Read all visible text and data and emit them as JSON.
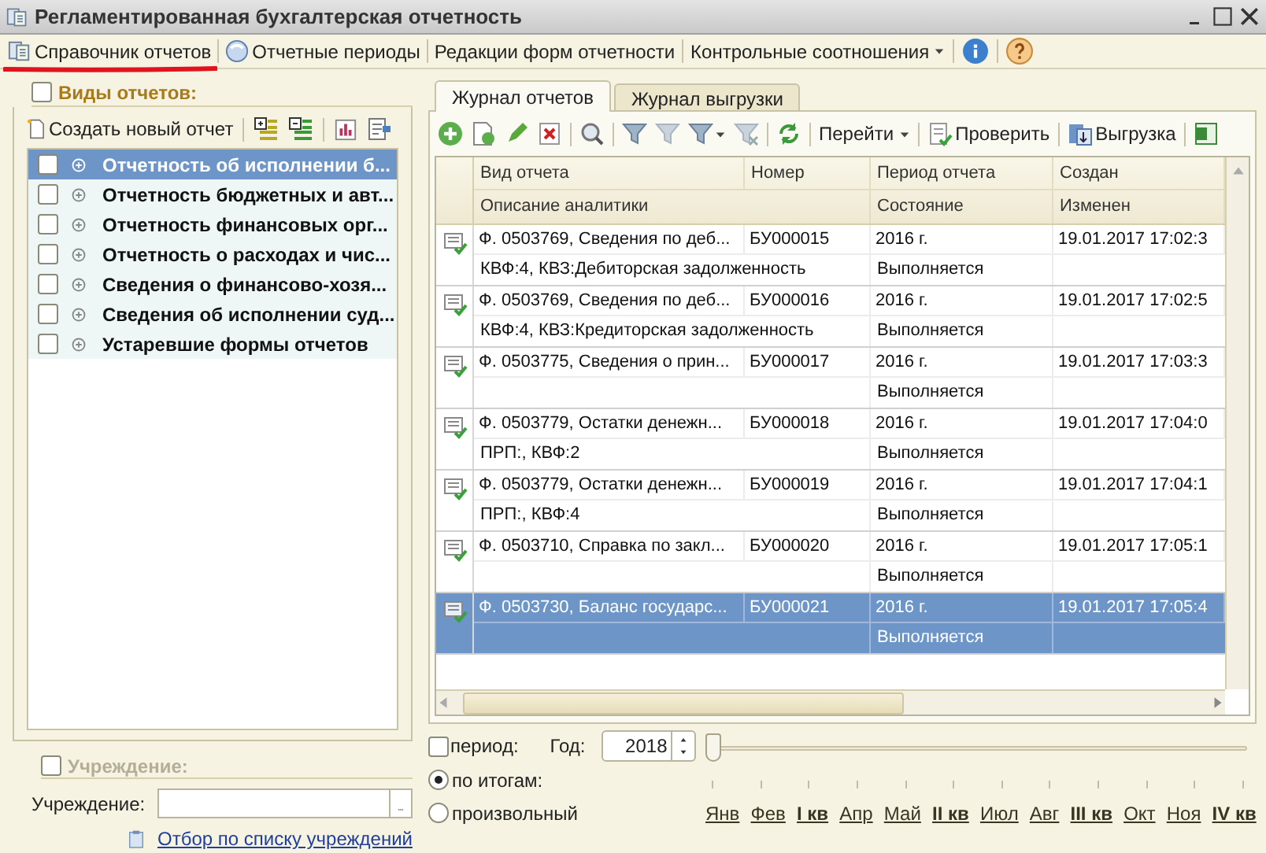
{
  "window": {
    "title": "Регламентированная бухгалтерская отчетность"
  },
  "toolbar": [
    {
      "kind": "button",
      "label": "Справочник отчетов"
    },
    {
      "kind": "button",
      "label": "Отчетные периоды"
    },
    {
      "kind": "button",
      "label": "Редакции форм отчетности"
    },
    {
      "kind": "menu",
      "label": "Контрольные соотношения"
    },
    {
      "kind": "icon"
    },
    {
      "kind": "icon"
    }
  ],
  "report_types": {
    "title": "Виды отчетов:",
    "checked": false,
    "create_button": "Создать новый отчет",
    "items": [
      {
        "label": "Отчетность об исполнении б...",
        "checked": false,
        "selected": true
      },
      {
        "label": "Отчетность бюджетных и авт...",
        "checked": false,
        "selected": false
      },
      {
        "label": "Отчетность финансовых орг...",
        "checked": false,
        "selected": false
      },
      {
        "label": "Отчетность о расходах и чис...",
        "checked": false,
        "selected": false
      },
      {
        "label": "Сведения о финансово-хозя...",
        "checked": false,
        "selected": false
      },
      {
        "label": "Сведения об исполнении суд...",
        "checked": false,
        "selected": false
      },
      {
        "label": "Устаревшие формы отчетов",
        "checked": false,
        "selected": false
      }
    ]
  },
  "institution": {
    "title": "Учреждение:",
    "checked": false,
    "field_label": "Учреждение:",
    "link": "Отбор по списку учреждений"
  },
  "tabs": [
    {
      "label": "Журнал отчетов",
      "selected": true
    },
    {
      "label": "Журнал выгрузки",
      "selected": false
    }
  ],
  "journal_toolbar": {
    "go": "Перейти",
    "check": "Проверить",
    "export": "Выгрузка"
  },
  "table": {
    "columns": [
      "Вид отчета",
      "Номер",
      "Период отчета",
      "Создан"
    ],
    "subcolumns": [
      "Описание аналитики",
      "Состояние",
      "Изменен"
    ],
    "rows": [
      {
        "type": "Ф. 0503769, Сведения по деб...",
        "number": "БУ000015",
        "period": "2016 г.",
        "created": "19.01.2017 17:02:3",
        "description": "КВФ:4, КВЗ:Дебиторская задолженность",
        "state": "Выполняется",
        "selected": false
      },
      {
        "type": "Ф. 0503769, Сведения по деб...",
        "number": "БУ000016",
        "period": "2016 г.",
        "created": "19.01.2017 17:02:5",
        "description": "КВФ:4, КВЗ:Кредиторская задолженность",
        "state": "Выполняется",
        "selected": false
      },
      {
        "type": "Ф. 0503775, Сведения о прин...",
        "number": "БУ000017",
        "period": "2016 г.",
        "created": "19.01.2017 17:03:3",
        "state": "Выполняется",
        "selected": false
      },
      {
        "type": "Ф. 0503779, Остатки денежн...",
        "number": "БУ000018",
        "period": "2016 г.",
        "created": "19.01.2017 17:04:0",
        "description": "ПРП:, КВФ:2",
        "state": "Выполняется",
        "selected": false
      },
      {
        "type": "Ф. 0503779, Остатки денежн...",
        "number": "БУ000019",
        "period": "2016 г.",
        "created": "19.01.2017 17:04:1",
        "description": "ПРП:, КВФ:4",
        "state": "Выполняется",
        "selected": false
      },
      {
        "type": "Ф. 0503710, Справка по закл...",
        "number": "БУ000020",
        "period": "2016 г.",
        "created": "19.01.2017 17:05:1",
        "state": "Выполняется",
        "selected": false
      },
      {
        "type": "Ф. 0503730, Баланс государс...",
        "number": "БУ000021",
        "period": "2016 г.",
        "created": "19.01.2017 17:05:4",
        "state": "Выполняется",
        "selected": true
      }
    ]
  },
  "period": {
    "label": "период:",
    "checked": false,
    "year_label": "Год:",
    "year": "2018",
    "level": 0,
    "modes": [
      {
        "label": "по итогам:",
        "selected": true
      },
      {
        "label": "произвольный",
        "selected": false
      }
    ],
    "months": [
      {
        "label": "Янв",
        "kind": "month"
      },
      {
        "label": "Фев",
        "kind": "month"
      },
      {
        "label": "I кв",
        "kind": "quarter"
      },
      {
        "label": "Апр",
        "kind": "month"
      },
      {
        "label": "Май",
        "kind": "month"
      },
      {
        "label": "II кв",
        "kind": "quarter"
      },
      {
        "label": "Июл",
        "kind": "month"
      },
      {
        "label": "Авг",
        "kind": "month"
      },
      {
        "label": "III кв",
        "kind": "quarter"
      },
      {
        "label": "Окт",
        "kind": "month"
      },
      {
        "label": "Ноя",
        "kind": "month"
      },
      {
        "label": "IV кв",
        "kind": "quarter"
      }
    ]
  }
}
